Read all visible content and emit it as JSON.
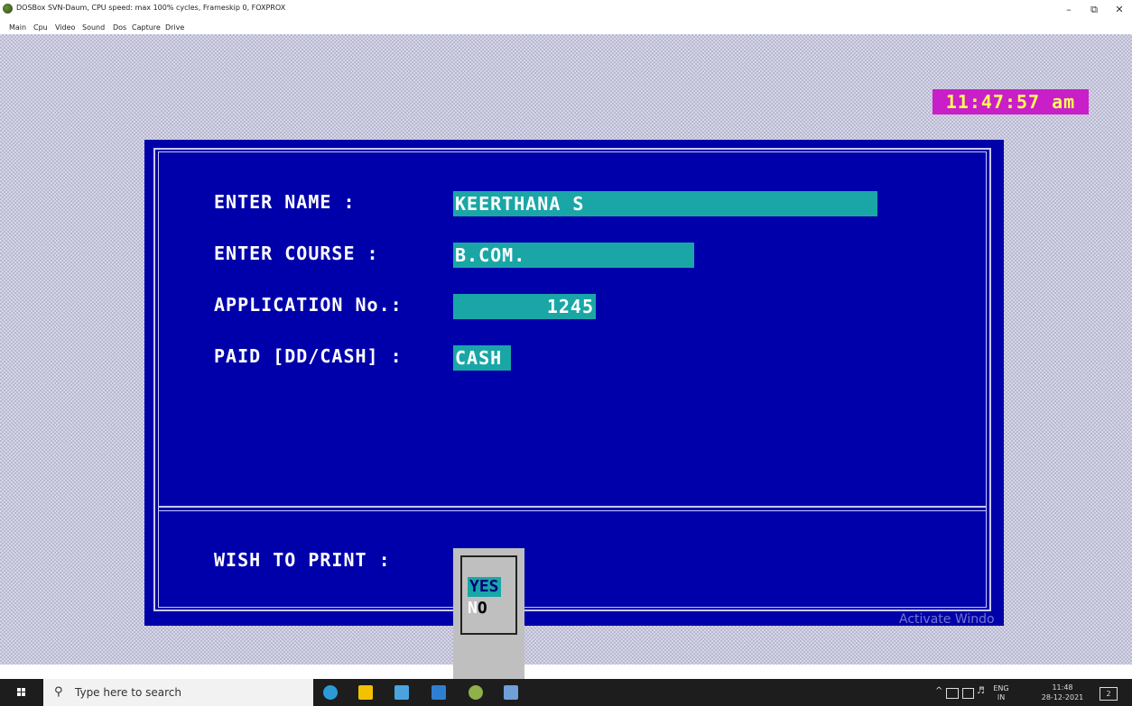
{
  "window": {
    "title": "DOSBox SVN-Daum, CPU speed: max 100% cycles, Frameskip 0, FOXPROX",
    "minimize_label": "–",
    "maximize_label": "⧉",
    "close_label": "✕",
    "menu": [
      "Main",
      "Cpu",
      "Video",
      "Sound",
      "Dos",
      "Capture",
      "Drive"
    ]
  },
  "dos": {
    "clock": "11:47:57 am",
    "form": {
      "name_label": "ENTER NAME     :",
      "name_value": "KEERTHANA S",
      "course_label": "ENTER COURSE   :",
      "course_value": "B.COM.",
      "appno_label": "APPLICATION No.:",
      "appno_value": "1245",
      "paid_label": "PAID [DD/CASH] :",
      "paid_value": "CASH",
      "print_label": "WISH TO PRINT  :"
    },
    "print_options": {
      "yes": "YES",
      "no_hotkey": "N",
      "no_rest": "O"
    },
    "watermark": "Activate Windo"
  },
  "taskbar": {
    "search_placeholder": "Type here to search",
    "apps": [
      {
        "icon": "edge-icon",
        "color": "#2b9bd8"
      },
      {
        "icon": "file-explorer-icon",
        "color": "#f2c200"
      },
      {
        "icon": "store-icon",
        "color": "#4aa3df"
      },
      {
        "icon": "mail-icon",
        "color": "#2f7fd1"
      },
      {
        "icon": "dosbox-icon",
        "color": "#8fb04a"
      },
      {
        "icon": "app-icon",
        "color": "#6fa0d8"
      }
    ],
    "lang_top": "ENG",
    "lang_bottom": "IN",
    "time": "11:48",
    "date": "28-12-2021",
    "notifications": "2"
  },
  "colors": {
    "dos_blue": "#0000aa",
    "field_cyan": "#1aa6a6",
    "clock_bg": "#c81fc8",
    "clock_fg": "#ffff55"
  }
}
